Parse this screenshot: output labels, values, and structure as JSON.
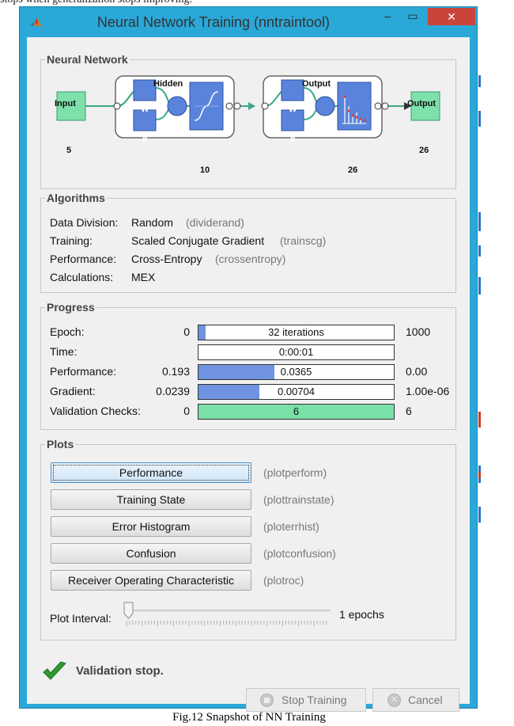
{
  "document": {
    "top_fragment": "stops when generalization stops improving.",
    "caption": "Fig.12 Snapshot of NN Training"
  },
  "window": {
    "title": "Neural Network Training (nntraintool)",
    "minimize_glyph": "–",
    "maximize_glyph": "▭",
    "close_glyph": "✕"
  },
  "network": {
    "panel_title": "Neural Network",
    "hidden_label": "Hidden",
    "output_layer_label": "Output",
    "input_label": "Input",
    "input_size": "5",
    "output_label": "Output",
    "output_size": "26",
    "hidden_size": "10",
    "output_layer_size": "26",
    "weight_glyph": "W",
    "bias_glyph": "b",
    "sum_glyph": "+"
  },
  "algorithms": {
    "panel_title": "Algorithms",
    "rows": [
      {
        "label": "Data Division:",
        "value": "Random",
        "fn": "(dividerand)"
      },
      {
        "label": "Training:",
        "value": "Scaled Conjugate Gradient",
        "fn": "(trainscg)"
      },
      {
        "label": "Performance:",
        "value": "Cross-Entropy",
        "fn": "(crossentropy)"
      },
      {
        "label": "Calculations:",
        "value": "MEX",
        "fn": ""
      }
    ]
  },
  "progress": {
    "panel_title": "Progress",
    "rows": [
      {
        "label": "Epoch:",
        "start": "0",
        "bar_text": "32 iterations",
        "end": "1000",
        "fill": 0.032
      },
      {
        "label": "Time:",
        "start": "",
        "bar_text": "0:00:01",
        "end": "",
        "fill": 0
      },
      {
        "label": "Performance:",
        "start": "0.193",
        "bar_text": "0.0365",
        "end": "0.00",
        "fill": 0.39
      },
      {
        "label": "Gradient:",
        "start": "0.0239",
        "bar_text": "0.00704",
        "end": "1.00e-06",
        "fill": 0.31
      },
      {
        "label": "Validation Checks:",
        "start": "0",
        "bar_text": "6",
        "end": "6",
        "fill": 1.0
      }
    ]
  },
  "plots": {
    "panel_title": "Plots",
    "buttons": [
      {
        "label": "Performance",
        "fn": "(plotperform)"
      },
      {
        "label": "Training State",
        "fn": "(plottrainstate)"
      },
      {
        "label": "Error Histogram",
        "fn": "(ploterrhist)"
      },
      {
        "label": "Confusion",
        "fn": "(plotconfusion)"
      },
      {
        "label": "Receiver Operating Characteristic",
        "fn": "(plotroc)"
      }
    ],
    "interval_label": "Plot Interval:",
    "interval_value": "1 epochs"
  },
  "status": {
    "message": "Validation stop."
  },
  "actions": {
    "stop_label": "Stop Training",
    "cancel_label": "Cancel"
  },
  "colors": {
    "titlebar": "#2aa8d8",
    "progress_blue": "#6f93e0",
    "progress_green": "#79e0a8",
    "node_green": "#7ee0aa",
    "node_blue": "#5a84dc",
    "close_red": "#c9443a"
  }
}
